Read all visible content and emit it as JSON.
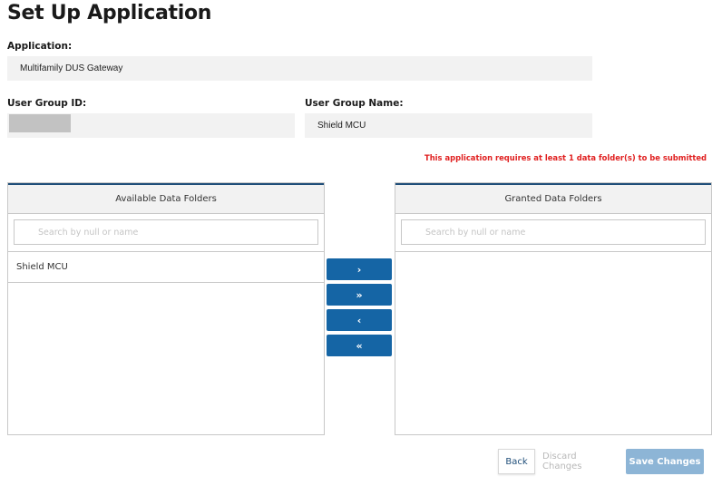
{
  "page": {
    "title": "Set Up Application"
  },
  "application": {
    "label": "Application:",
    "value": "Multifamily DUS Gateway"
  },
  "user_group": {
    "id_label": "User Group ID:",
    "name_label": "User Group Name:",
    "name_value": "Shield MCU"
  },
  "warning": "This application requires at least 1 data folder(s) to be submitted",
  "available": {
    "header": "Available Data Folders",
    "search_placeholder": "Search by null or name",
    "items": [
      "Shield MCU"
    ]
  },
  "granted": {
    "header": "Granted Data Folders",
    "search_placeholder": "Search by null or name",
    "items": []
  },
  "transfer": {
    "move_right": "›",
    "move_all_right": "»",
    "move_left": "‹",
    "move_all_left": "«"
  },
  "actions": {
    "back": "Back",
    "discard": "Discard Changes",
    "save": "Save Changes"
  },
  "colors": {
    "primary": "#1565a5",
    "panel_accent": "#1f4e79",
    "warning": "#e02020",
    "save_disabled": "#8db5d6"
  }
}
